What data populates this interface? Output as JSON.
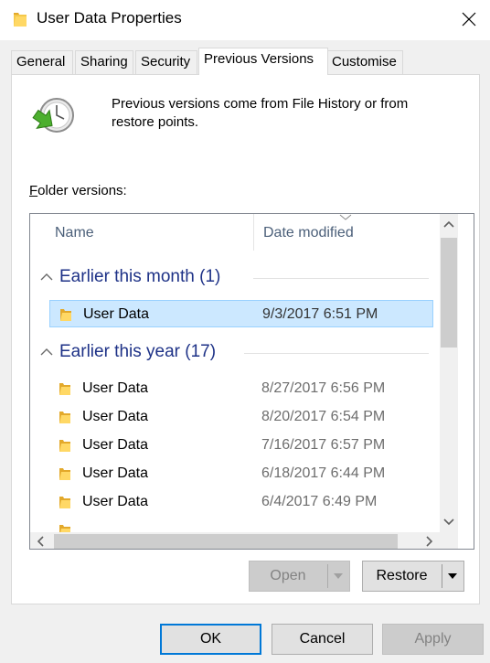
{
  "window": {
    "title": "User Data Properties"
  },
  "tabs": [
    {
      "label": "General"
    },
    {
      "label": "Sharing"
    },
    {
      "label": "Security"
    },
    {
      "label": "Previous Versions",
      "active": true
    },
    {
      "label": "Customise"
    }
  ],
  "info": {
    "text": "Previous versions come from File History or from restore points."
  },
  "folder_versions": {
    "label_prefix": "F",
    "label_rest": "older versions:"
  },
  "columns": {
    "name": "Name",
    "date": "Date modified"
  },
  "groups": [
    {
      "label": "Earlier this month (1)",
      "items": [
        {
          "name": "User Data",
          "date": "9/3/2017 6:51 PM",
          "selected": true
        }
      ]
    },
    {
      "label": "Earlier this year (17)",
      "items": [
        {
          "name": "User Data",
          "date": "8/27/2017 6:56 PM"
        },
        {
          "name": "User Data",
          "date": "8/20/2017 6:54 PM"
        },
        {
          "name": "User Data",
          "date": "7/16/2017 6:57 PM"
        },
        {
          "name": "User Data",
          "date": "6/18/2017 6:44 PM"
        },
        {
          "name": "User Data",
          "date": "6/4/2017 6:49 PM"
        }
      ]
    }
  ],
  "buttons": {
    "open": "Open",
    "restore": "Restore",
    "ok": "OK",
    "cancel": "Cancel",
    "apply": "Apply"
  },
  "icons": {
    "folder": "folder-icon",
    "history": "history-clock-icon",
    "close": "close-icon"
  },
  "colors": {
    "group_header": "#1e3287",
    "selection": "#cce8ff",
    "default_button_border": "#0078d7"
  }
}
